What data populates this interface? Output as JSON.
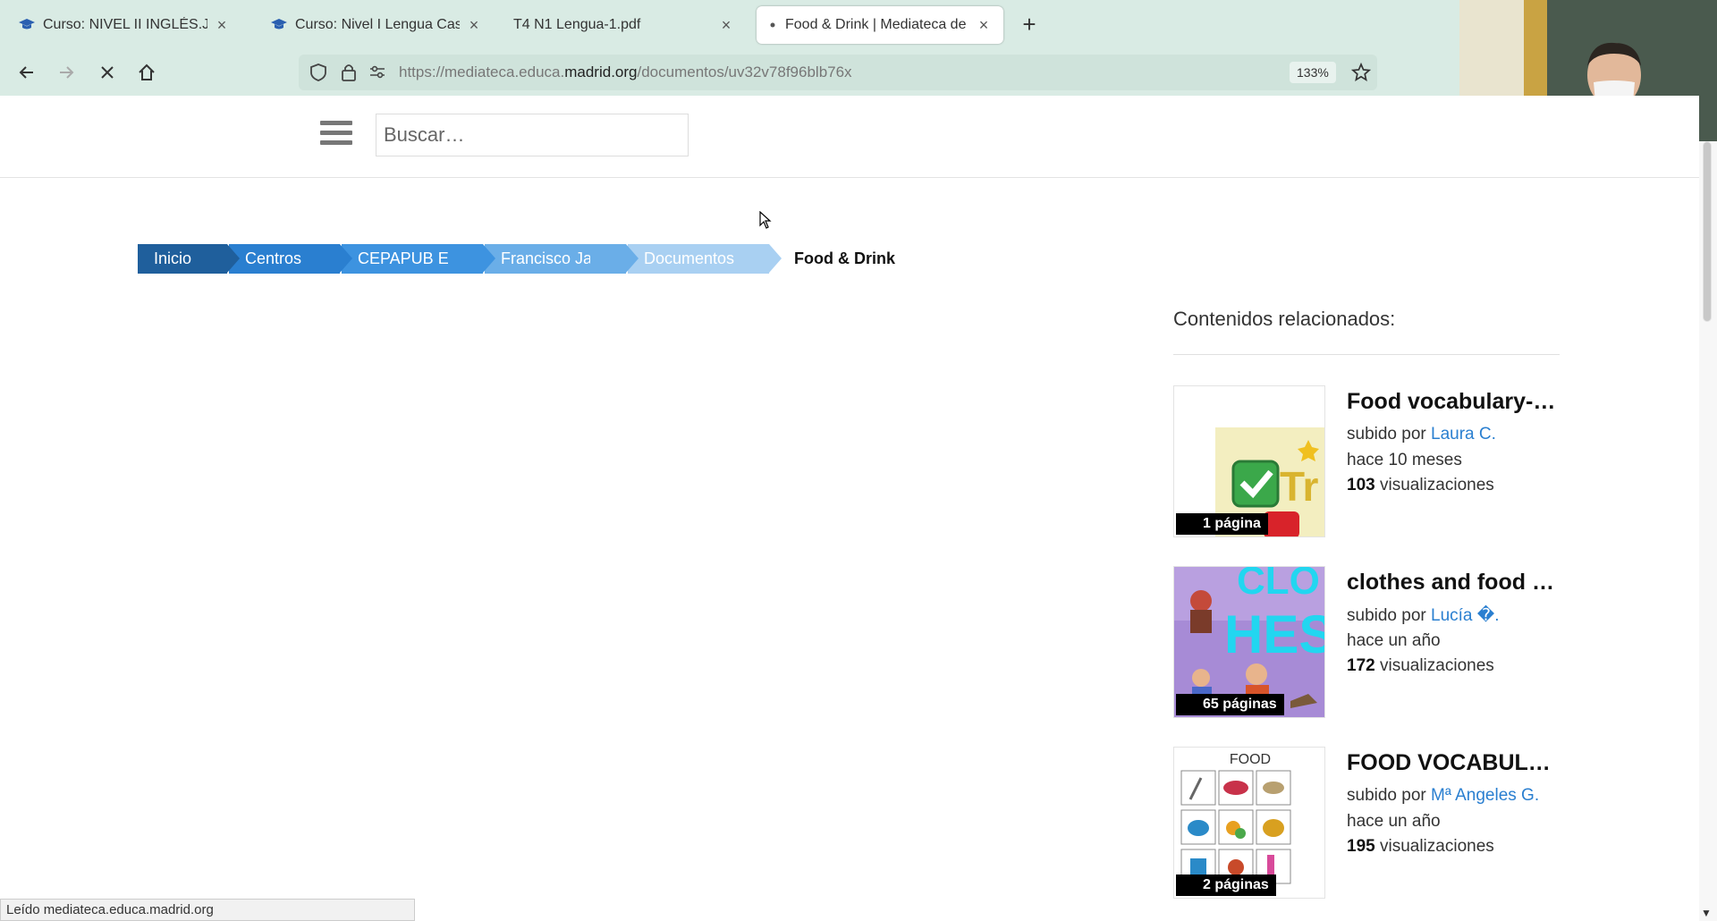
{
  "browser": {
    "tabs": [
      {
        "title": "Curso: NIVEL II INGLÉS.JAVIER",
        "icon": "graduation-cap-icon"
      },
      {
        "title": "Curso: Nivel I Lengua Castellana",
        "icon": "graduation-cap-icon"
      },
      {
        "title": "T4 N1 Lengua-1.pdf",
        "icon": ""
      },
      {
        "title": "Food & Drink | Mediateca de EducaMadrid",
        "icon": "loading-dot-icon",
        "active": true
      }
    ],
    "url_prefix": "https://mediateca.educa.",
    "url_domain": "madrid.org",
    "url_path": "/documentos/uv32v78f96blb76x",
    "zoom": "133%",
    "status": "Leído mediateca.educa.madrid.org"
  },
  "header": {
    "search_placeholder": "Buscar…"
  },
  "breadcrumb": [
    {
      "label": "Inicio"
    },
    {
      "label": "Centros"
    },
    {
      "label": "CEPAPUB E"
    },
    {
      "label": "Francisco Ja"
    },
    {
      "label": "Documentos"
    },
    {
      "label": "Food & Drink"
    }
  ],
  "related": {
    "title": "Contenidos relacionados:",
    "items": [
      {
        "title": "Food vocabulary-…",
        "uploaded_prefix": "subido por ",
        "author": "Laura C.",
        "age": "hace 10 meses",
        "views": "103",
        "views_label": " visualizaciones",
        "pages": "1 página"
      },
      {
        "title": "clothes and food …",
        "uploaded_prefix": "subido por ",
        "author": "Lucía �.",
        "age": "hace un año",
        "views": "172",
        "views_label": " visualizaciones",
        "pages": "65 páginas"
      },
      {
        "title": "FOOD VOCABUL…",
        "uploaded_prefix": "subido por ",
        "author": "Mª Angeles G.",
        "age": "hace un año",
        "views": "195",
        "views_label": " visualizaciones",
        "pages": "2 páginas",
        "thumb_text": "FOOD"
      }
    ]
  },
  "colors": {
    "chrome_bg": "#d9ebe4",
    "link": "#2a7fd0",
    "crumb_dark": "#1f5f9c"
  }
}
